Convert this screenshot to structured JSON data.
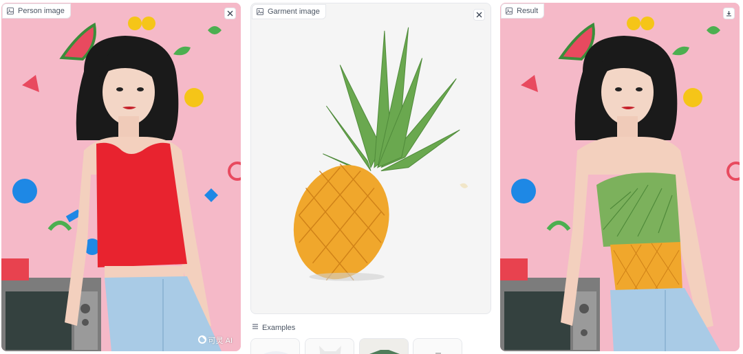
{
  "panels": {
    "person": {
      "label": "Person image",
      "icon": "image-icon",
      "action_icon": "close-icon",
      "watermark": "可灵 AI"
    },
    "garment": {
      "label": "Garment image",
      "icon": "image-icon",
      "action_icon": "close-icon"
    },
    "result": {
      "label": "Result",
      "icon": "image-icon",
      "action_icon": "download-icon"
    }
  },
  "examples": {
    "label": "Examples",
    "icon": "list-icon",
    "items": [
      {
        "name": "white-tshirt"
      },
      {
        "name": "white-tank"
      },
      {
        "name": "green-shirt"
      },
      {
        "name": "white-top"
      }
    ]
  },
  "colors": {
    "wall_pink": "#f5b9c8",
    "tank_red": "#e8232f",
    "jeans_blue": "#a9cbe6",
    "pineapple_orange": "#f0a72c",
    "pineapple_leaf": "#6aa84f"
  }
}
